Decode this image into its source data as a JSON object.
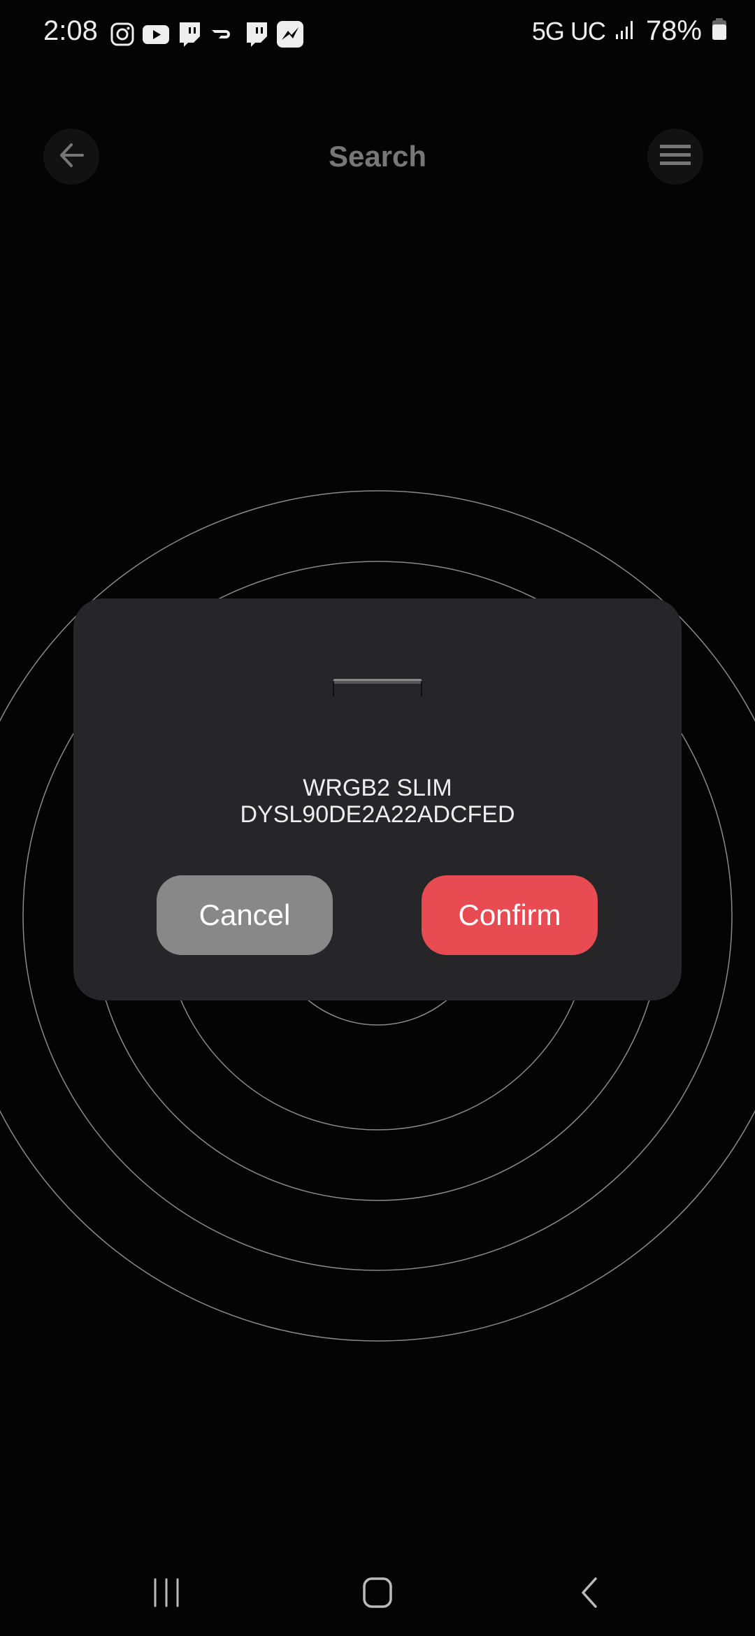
{
  "status_bar": {
    "time": "2:08",
    "notification_icons": [
      "instagram-icon",
      "youtube-icon",
      "twitch-icon",
      "doordash-icon",
      "twitch-icon",
      "messenger-icon"
    ],
    "network": "5G UC",
    "battery_percent": "78%",
    "battery_level": 0.78
  },
  "header": {
    "title": "Search",
    "back_icon": "arrow-left-icon",
    "menu_icon": "hamburger-menu-icon"
  },
  "dialog": {
    "device_image": "led-light-fixture",
    "device_name": "WRGB2 SLIM",
    "device_id": "DYSL90DE2A22ADCFED",
    "cancel_label": "Cancel",
    "confirm_label": "Confirm",
    "colors": {
      "cancel": "#888888",
      "confirm": "#e84b52",
      "panel": "#262628"
    }
  },
  "navbar": {
    "recents_icon": "recent-apps-icon",
    "home_icon": "home-icon",
    "back_icon": "back-icon"
  }
}
